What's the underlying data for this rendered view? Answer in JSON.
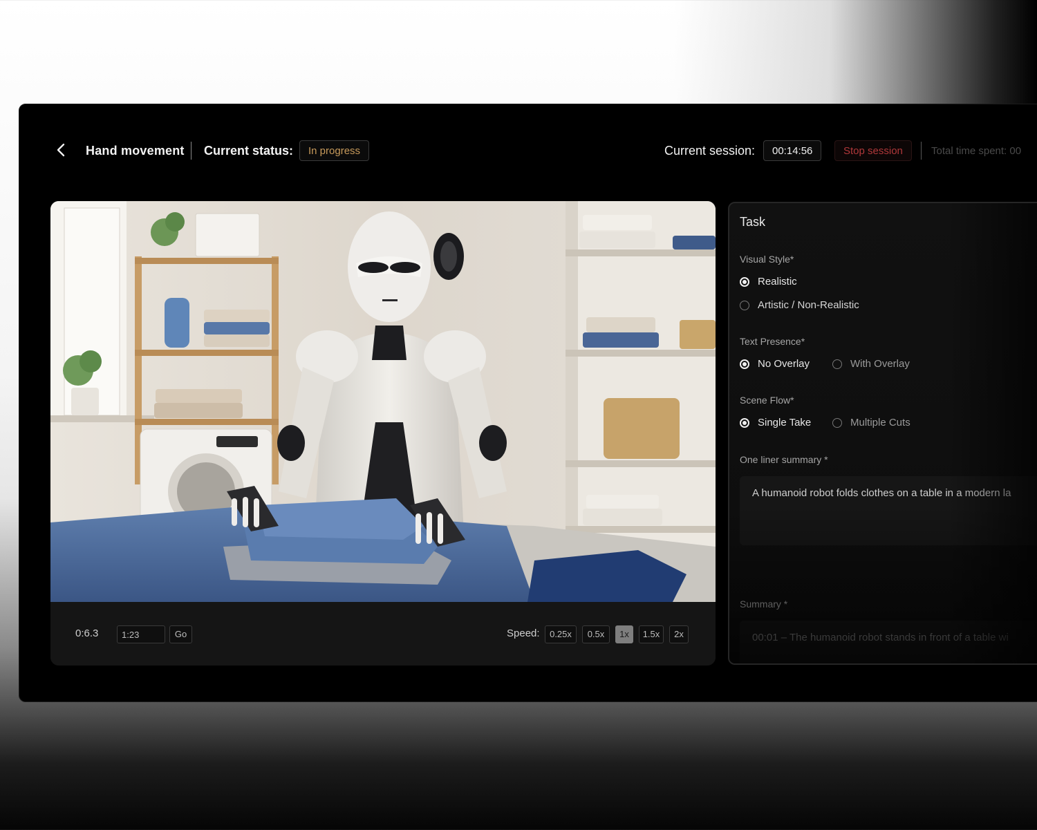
{
  "header": {
    "task_name": "Hand movement",
    "status_label": "Current status:",
    "status_value": "In progress",
    "session_label": "Current session:",
    "session_timer": "00:14:56",
    "stop_label": "Stop session",
    "total_time_label": "Total time spent: 00"
  },
  "player": {
    "current_time": "0:6.3",
    "seek_value": "1:23",
    "go_label": "Go",
    "speed_label": "Speed:",
    "speeds": [
      "0.25x",
      "0.5x",
      "1x",
      "1.5x",
      "2x"
    ],
    "active_speed": "1x"
  },
  "task": {
    "title": "Task",
    "visual_style": {
      "label": "Visual Style*",
      "options": [
        "Realistic",
        "Artistic / Non-Realistic"
      ],
      "selected": "Realistic"
    },
    "text_presence": {
      "label": "Text Presence*",
      "options": [
        "No Overlay",
        "With Overlay"
      ],
      "selected": "No Overlay"
    },
    "scene_flow": {
      "label": "Scene Flow*",
      "options": [
        "Single Take",
        "Multiple Cuts"
      ],
      "selected": "Single Take"
    },
    "one_liner": {
      "label": "One liner summary *",
      "value": "A humanoid robot folds clothes on a table in a modern la"
    },
    "summary": {
      "label": "Summary *",
      "value": "00:01 – The humanoid robot stands in front of a table wi"
    }
  },
  "colors": {
    "status_accent": "#c79a5b",
    "stop_accent": "#b0383a",
    "background": "#000000"
  }
}
